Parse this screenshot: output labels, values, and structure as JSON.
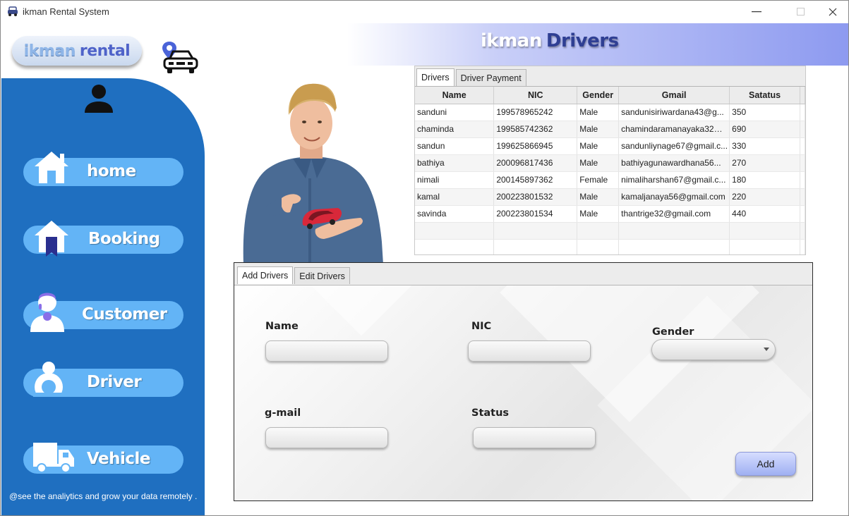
{
  "window": {
    "title": "ikman Rental System"
  },
  "sidebar": {
    "logo": {
      "part1": "ikman",
      "part2": "rental"
    },
    "items": [
      {
        "label": "home",
        "icon": "house-icon"
      },
      {
        "label": "Booking",
        "icon": "booking-house-icon"
      },
      {
        "label": "Customer",
        "icon": "customer-icon"
      },
      {
        "label": "Driver",
        "icon": "driver-icon"
      },
      {
        "label": "Vehicle",
        "icon": "truck-icon"
      }
    ],
    "footer": "@see the analiytics and grow your data remotely ."
  },
  "header": {
    "title_part1": "ikman",
    "title_part2": "Drivers"
  },
  "drivers_panel": {
    "tabs": [
      "Drivers",
      "Driver Payment"
    ],
    "columns": [
      "Name",
      "NIC",
      "Gender",
      "Gmail",
      "Satatus"
    ],
    "rows": [
      [
        "sanduni",
        "199578965242",
        "Male",
        "sandunisiriwardana43@g...",
        "350"
      ],
      [
        "chaminda",
        "199585742362",
        "Male",
        "chamindaramanayaka32@...",
        "690"
      ],
      [
        "sandun",
        "199625866945",
        "Male",
        "sandunliynage67@gmail.c...",
        "330"
      ],
      [
        "bathiya",
        "200096817436",
        "Male",
        "bathiyagunawardhana56...",
        "270"
      ],
      [
        "nimali",
        "200145897362",
        "Female",
        "nimaliharshan67@gmail.c...",
        "180"
      ],
      [
        "kamal",
        "200223801532",
        "Male",
        "kamaljanaya56@gmail.com",
        "220"
      ],
      [
        "savinda",
        "200223801534",
        "Male",
        "thantrige32@gmail.com",
        "440"
      ]
    ]
  },
  "form_panel": {
    "tabs": [
      "Add Drivers",
      "Edit Drivers"
    ],
    "labels": {
      "name": "Name",
      "nic": "NIC",
      "gender": "Gender",
      "gmail": "g-mail",
      "status": "Status"
    },
    "add_button": "Add"
  },
  "colors": {
    "sidebar": "#1f6fc0",
    "nav_button": "#63b4f6",
    "header_accent": "#8d9af0",
    "title_dark": "#2f3f93"
  }
}
